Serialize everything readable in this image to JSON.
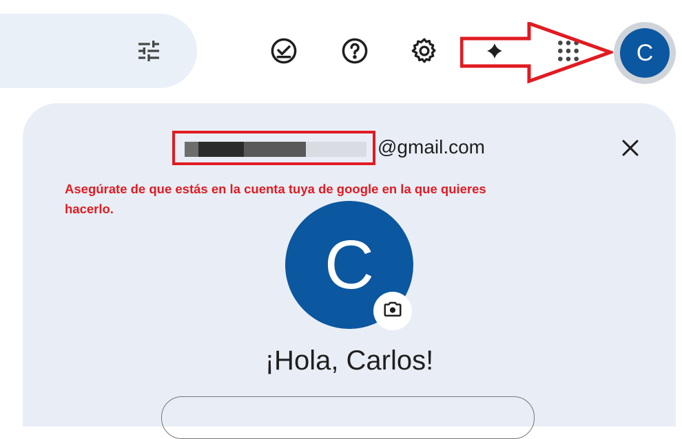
{
  "toolbar": {
    "icons": [
      "tune-icon",
      "task-check-icon",
      "help-icon",
      "settings-icon",
      "gemini-icon",
      "apps-grid-icon"
    ],
    "account_avatar_letter": "C",
    "avatar_color": "#0b57a0"
  },
  "account_panel": {
    "email_domain": "@gmail.com",
    "annotation": "Asegúrate de que estás en la cuenta tuya de google en la que quieres hacerlo.",
    "annotation_line1": "Asegúrate de que estás en la cuenta tuya de google en la que quieres",
    "annotation_line2": "hacerlo.",
    "avatar_letter": "C",
    "greeting": "¡Hola, Carlos!",
    "annotation_color": "#e11b22"
  }
}
